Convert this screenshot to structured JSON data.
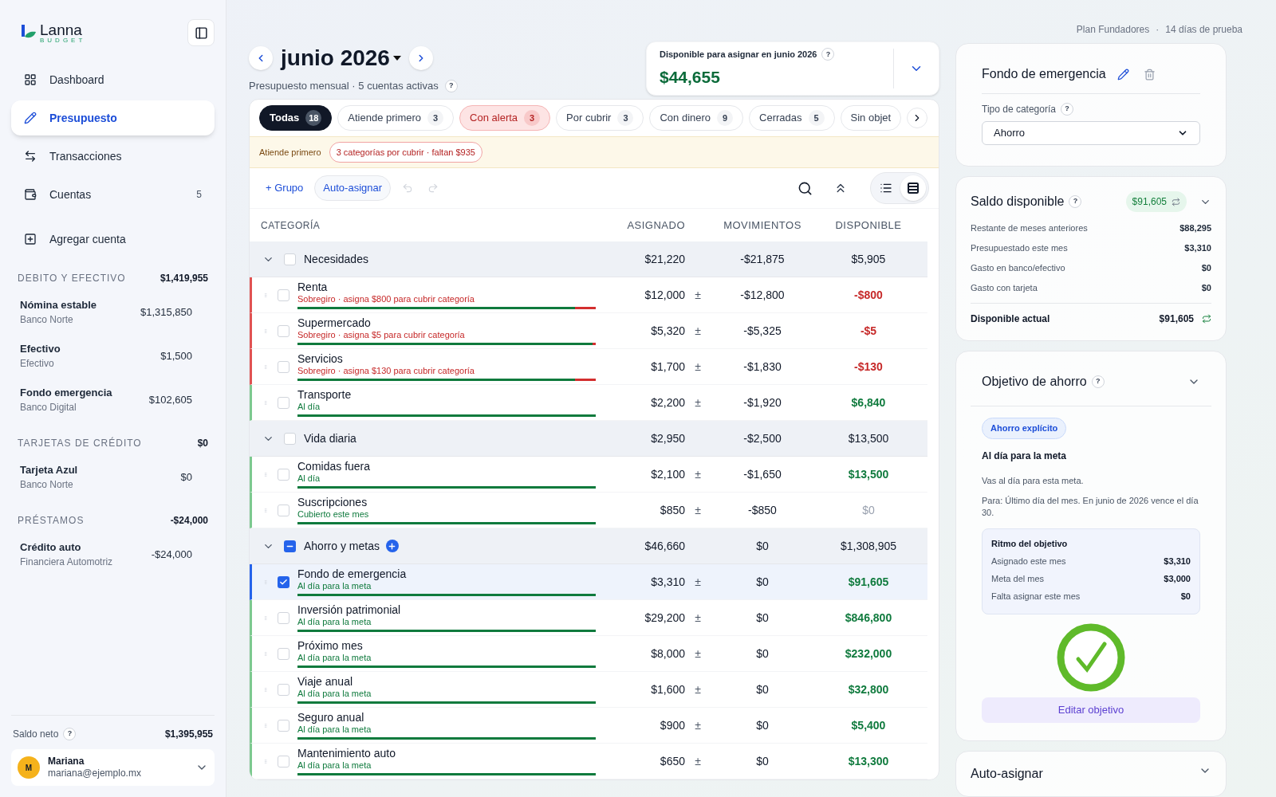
{
  "sidebar": {
    "logo": {
      "name": "Lanna",
      "tagline": "BUDGET"
    },
    "nav": [
      {
        "label": "Dashboard",
        "selected": false
      },
      {
        "label": "Presupuesto",
        "selected": true
      },
      {
        "label": "Transacciones",
        "selected": false
      },
      {
        "label": "Cuentas",
        "selected": false,
        "count": "5"
      }
    ],
    "add_account": "Agregar cuenta",
    "account_groups": [
      {
        "title": "DEBITO Y EFECTIVO",
        "total": "$1,419,955",
        "accounts": [
          {
            "name": "Nómina estable",
            "bank": "Banco Norte",
            "balance": "$1,315,850"
          },
          {
            "name": "Efectivo",
            "bank": "Efectivo",
            "balance": "$1,500"
          },
          {
            "name": "Fondo emergencia",
            "bank": "Banco Digital",
            "balance": "$102,605"
          }
        ]
      },
      {
        "title": "TARJETAS DE CRÉDITO",
        "total": "$0",
        "accounts": [
          {
            "name": "Tarjeta Azul",
            "bank": "Banco Norte",
            "balance": "$0"
          }
        ]
      },
      {
        "title": "PRÉSTAMOS",
        "total": "-$24,000",
        "accounts": [
          {
            "name": "Crédito auto",
            "bank": "Financiera Automotriz",
            "balance": "-$24,000"
          }
        ]
      }
    ],
    "net": {
      "label": "Saldo neto",
      "help": "?",
      "value": "$1,395,955"
    },
    "user": {
      "initial": "M",
      "name": "Mariana",
      "email": "mariana@ejemplo.mx"
    }
  },
  "header": {
    "month": "junio 2026",
    "subtitle": "Presupuesto mensual · 5 cuentas activas",
    "help": "?",
    "plan": "Plan Fundadores",
    "separator": "·",
    "trial": "14 días de prueba",
    "available": {
      "label": "Disponible para asignar en junio 2026",
      "help": "?",
      "value": "$44,655"
    }
  },
  "filters": [
    {
      "label": "Todas",
      "count": "18",
      "selected": true,
      "alert": false
    },
    {
      "label": "Atiende primero",
      "count": "3",
      "selected": false,
      "alert": false
    },
    {
      "label": "Con alerta",
      "count": "3",
      "selected": false,
      "alert": true
    },
    {
      "label": "Por cubrir",
      "count": "3",
      "selected": false,
      "alert": false
    },
    {
      "label": "Con dinero",
      "count": "9",
      "selected": false,
      "alert": false
    },
    {
      "label": "Cerradas",
      "count": "5",
      "selected": false,
      "alert": false
    },
    {
      "label": "Sin objet",
      "selected": false,
      "alert": false
    }
  ],
  "alert_bar": {
    "label": "Atiende primero",
    "badge": "3 categorías por cubrir · faltan $935"
  },
  "toolbar": {
    "add_group": "+ Grupo",
    "auto_assign": "Auto-asignar",
    "views": [
      {
        "selected": false
      },
      {
        "selected": true
      }
    ]
  },
  "table": {
    "columns": [
      "CATEGORÍA",
      "ASIGNADO",
      "MOVIMIENTOS",
      "DISPONIBLE"
    ],
    "groups": [
      {
        "name": "Necesidades",
        "expanded": true,
        "checked": false,
        "partial": false,
        "add_button": false,
        "assigned": "$21,220",
        "activity": "-$21,875",
        "available": "$5,905",
        "items": [
          {
            "name": "Renta",
            "kind": "overspent",
            "status": "Sobregiro · asigna $800 para cubrir categoría",
            "level": 0.93,
            "assigned": "$12,000",
            "adjust": "±",
            "activity": "-$12,800",
            "available": "-$800",
            "checked": false,
            "selected": false
          },
          {
            "name": "Supermercado",
            "kind": "overspent",
            "status": "Sobregiro · asigna $5 para cubrir categoría",
            "level": 0.99,
            "assigned": "$5,320",
            "adjust": "±",
            "activity": "-$5,325",
            "available": "-$5",
            "checked": false,
            "selected": false
          },
          {
            "name": "Servicios",
            "kind": "overspent",
            "status": "Sobregiro · asigna $130 para cubrir categoría",
            "level": 0.93,
            "assigned": "$1,700",
            "adjust": "±",
            "activity": "-$1,830",
            "available": "-$130",
            "checked": false,
            "selected": false
          },
          {
            "name": "Transporte",
            "kind": "funded",
            "status": "Al día",
            "level": 1,
            "assigned": "$2,200",
            "adjust": "±",
            "activity": "-$1,920",
            "available": "$6,840",
            "checked": false,
            "selected": false
          }
        ]
      },
      {
        "name": "Vida diaria",
        "expanded": true,
        "checked": false,
        "partial": false,
        "add_button": false,
        "assigned": "$2,950",
        "activity": "-$2,500",
        "available": "$13,500",
        "items": [
          {
            "name": "Comidas fuera",
            "kind": "funded",
            "status": "Al día",
            "level": 1,
            "assigned": "$2,100",
            "adjust": "±",
            "activity": "-$1,650",
            "available": "$13,500",
            "checked": false,
            "selected": false
          },
          {
            "name": "Suscripciones",
            "kind": "covered",
            "status": "Cubierto este mes",
            "level": 1,
            "assigned": "$850",
            "adjust": "±",
            "activity": "-$850",
            "available": "$0",
            "checked": false,
            "selected": false
          }
        ]
      },
      {
        "name": "Ahorro y metas",
        "expanded": true,
        "checked": false,
        "partial": true,
        "add_button": true,
        "assigned": "$46,660",
        "activity": "$0",
        "available": "$1,308,905",
        "items": [
          {
            "name": "Fondo de emergencia",
            "kind": "funded",
            "status": "Al día para la meta",
            "level": 1,
            "assigned": "$3,310",
            "adjust": "±",
            "activity": "$0",
            "available": "$91,605",
            "checked": true,
            "selected": true
          },
          {
            "name": "Inversión patrimonial",
            "kind": "funded",
            "status": "Al día para la meta",
            "level": 1,
            "assigned": "$29,200",
            "adjust": "±",
            "activity": "$0",
            "available": "$846,800",
            "checked": false,
            "selected": false
          },
          {
            "name": "Próximo mes",
            "kind": "funded",
            "status": "Al día para la meta",
            "level": 1,
            "assigned": "$8,000",
            "adjust": "±",
            "activity": "$0",
            "available": "$232,000",
            "checked": false,
            "selected": false
          },
          {
            "name": "Viaje anual",
            "kind": "funded",
            "status": "Al día para la meta",
            "level": 1,
            "assigned": "$1,600",
            "adjust": "±",
            "activity": "$0",
            "available": "$32,800",
            "checked": false,
            "selected": false
          },
          {
            "name": "Seguro anual",
            "kind": "funded",
            "status": "Al día para la meta",
            "level": 1,
            "assigned": "$900",
            "adjust": "±",
            "activity": "$0",
            "available": "$5,400",
            "checked": false,
            "selected": false
          },
          {
            "name": "Mantenimiento auto",
            "kind": "funded",
            "status": "Al día para la meta",
            "level": 1,
            "assigned": "$650",
            "adjust": "±",
            "activity": "$0",
            "available": "$13,300",
            "checked": false,
            "selected": false
          }
        ]
      }
    ]
  },
  "category_card": {
    "title": "Fondo de emergencia",
    "type_label": "Tipo de categoría",
    "help": "?",
    "type_value": "Ahorro"
  },
  "balance_card": {
    "title": "Saldo disponible",
    "help": "?",
    "badge": "$91,605",
    "rows": [
      {
        "label": "Restante de meses anteriores",
        "value": "$88,295"
      },
      {
        "label": "Presupuestado este mes",
        "value": "$3,310"
      },
      {
        "label": "Gasto en banco/efectivo",
        "value": "$0"
      },
      {
        "label": "Gasto con tarjeta",
        "value": "$0"
      }
    ],
    "total": {
      "label": "Disponible actual",
      "value": "$91,605"
    }
  },
  "goal_card": {
    "title": "Objetivo de ahorro",
    "help": "?",
    "tag": "Ahorro explícito",
    "status": "Al día para la meta",
    "note": "Vas al día para esta meta.",
    "due": "Para: Último día del mes. En junio de 2026 vence el día 30.",
    "pace": {
      "title": "Ritmo del objetivo",
      "rows": [
        {
          "label": "Asignado este mes",
          "value": "$3,310"
        },
        {
          "label": "Meta del mes",
          "value": "$3,000"
        },
        {
          "label": "Falta asignar este mes",
          "value": "$0"
        }
      ]
    },
    "on_track": true,
    "button": "Editar objetivo"
  },
  "auto_card": {
    "title": "Auto-asignar"
  }
}
